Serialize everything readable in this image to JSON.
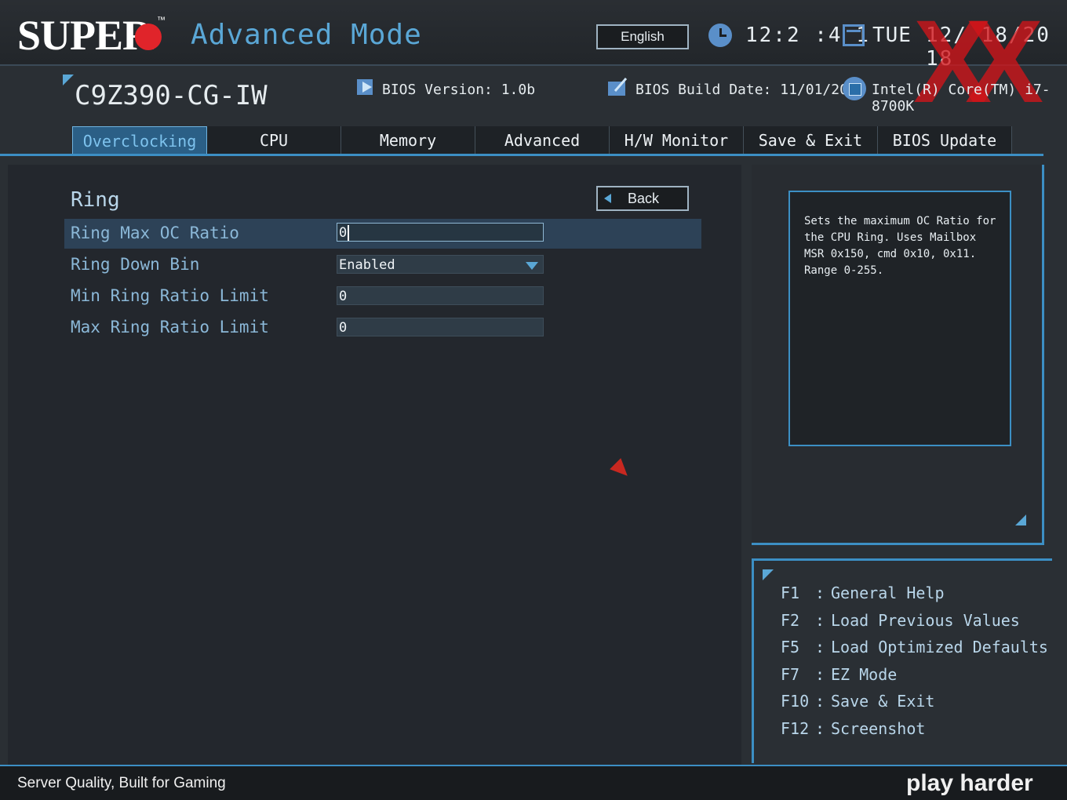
{
  "header": {
    "logo": "SUPER",
    "mode": "Advanced Mode",
    "language": "English",
    "time": "12:2 :4 1",
    "day": "TUE",
    "date": "12/ 18/20 18",
    "watermark": "XX"
  },
  "info": {
    "model": "C9Z390-CG-IW",
    "bios_version": "BIOS Version: 1.0b",
    "build_date": "BIOS Build Date: 11/01/2018",
    "cpu": "Intel(R) Core(TM) i7-8700K"
  },
  "tabs": [
    {
      "label": "Overclocking"
    },
    {
      "label": "CPU"
    },
    {
      "label": "Memory"
    },
    {
      "label": "Advanced"
    },
    {
      "label": "H/W Monitor"
    },
    {
      "label": "Save & Exit"
    },
    {
      "label": "BIOS Update"
    }
  ],
  "section": {
    "title": "Ring",
    "back_label": "Back"
  },
  "settings": [
    {
      "label": "Ring Max OC Ratio",
      "value": "0"
    },
    {
      "label": "Ring Down Bin",
      "value": "Enabled"
    },
    {
      "label": "Min Ring Ratio Limit",
      "value": "0"
    },
    {
      "label": "Max Ring Ratio Limit",
      "value": "0"
    }
  ],
  "help": {
    "text": "Sets the maximum OC Ratio for the CPU Ring. Uses Mailbox MSR 0x150, cmd 0x10, 0x11. Range 0-255."
  },
  "keys": [
    {
      "key": "F1",
      "desc": "General Help"
    },
    {
      "key": "F2",
      "desc": "Load Previous Values"
    },
    {
      "key": "F5",
      "desc": "Load Optimized Defaults"
    },
    {
      "key": "F7",
      "desc": "EZ Mode"
    },
    {
      "key": "F10",
      "desc": "Save & Exit"
    },
    {
      "key": "F12",
      "desc": "Screenshot"
    }
  ],
  "footer": {
    "tagline": "Server Quality, Built for Gaming",
    "brand": "play harder"
  },
  "colors": {
    "accent": "#3c8fc4",
    "active_tab": "#2b5f86",
    "label": "#8bb8d8",
    "logo_red": "#e0242a"
  }
}
